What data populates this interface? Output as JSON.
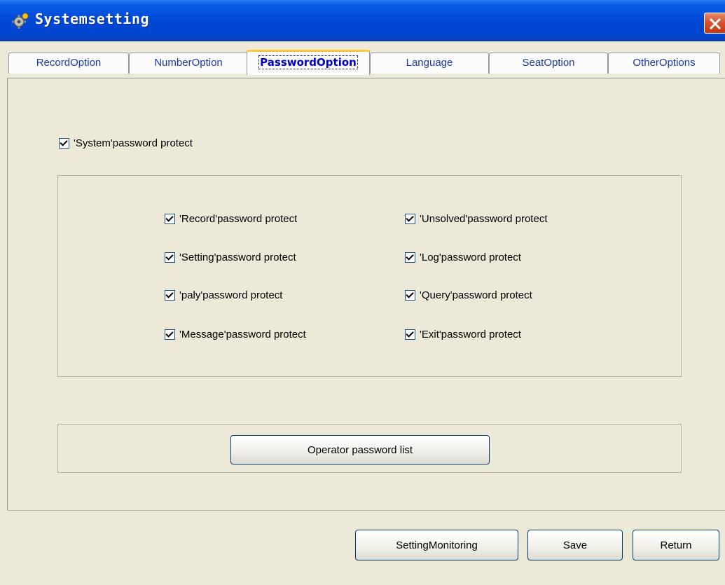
{
  "window": {
    "title": "Systemsetting",
    "icon": "gear-icon",
    "close_icon": "close-icon"
  },
  "tabs": [
    {
      "label": "RecordOption",
      "active": false
    },
    {
      "label": "NumberOption",
      "active": false
    },
    {
      "label": "PasswordOption",
      "active": true
    },
    {
      "label": "Language",
      "active": false
    },
    {
      "label": "SeatOption",
      "active": false
    },
    {
      "label": "OtherOptions",
      "active": false
    }
  ],
  "password_option": {
    "system_protect": {
      "label": "'System'password protect",
      "checked": true
    },
    "protect_items": [
      {
        "label": "'Record'password protect",
        "checked": true
      },
      {
        "label": "'Unsolved'password protect",
        "checked": true
      },
      {
        "label": "'Setting'password protect",
        "checked": true
      },
      {
        "label": "'Log'password protect",
        "checked": true
      },
      {
        "label": "'paly'password protect",
        "checked": true
      },
      {
        "label": "'Query'password protect",
        "checked": true
      },
      {
        "label": "'Message'password protect",
        "checked": true
      },
      {
        "label": "'Exit'password protect",
        "checked": true
      }
    ],
    "operator_list_button": "Operator password list"
  },
  "footer": {
    "setting_monitoring": "SettingMonitoring",
    "save": "Save",
    "return": "Return"
  },
  "colors": {
    "titlebar": "#0046cf",
    "background": "#ece9d8",
    "active_tab_text": "#0000c0",
    "tab_text": "#1a3a9a",
    "active_tab_accent": "#ffc83c"
  }
}
